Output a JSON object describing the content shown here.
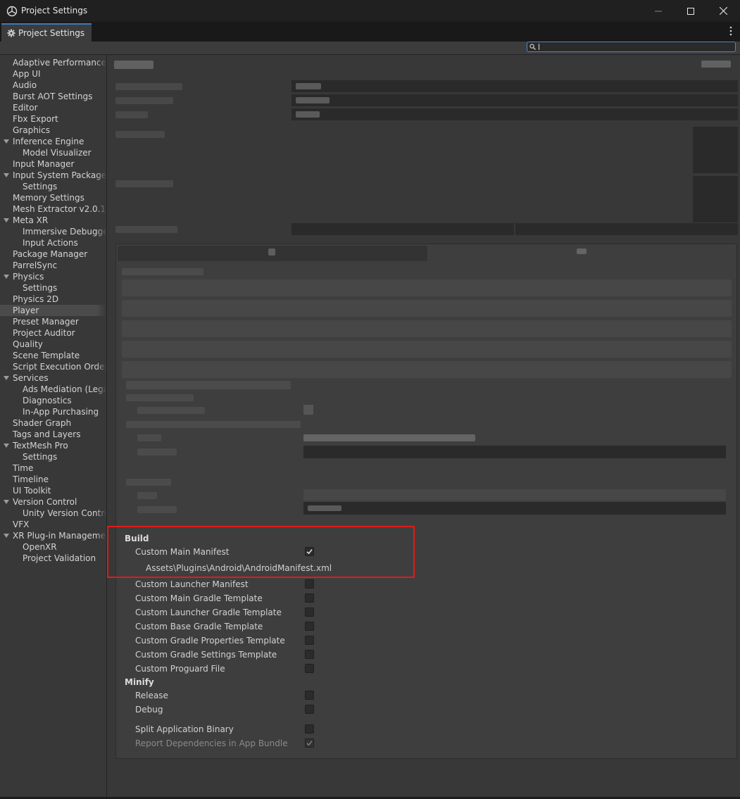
{
  "window": {
    "title": "Project Settings"
  },
  "tab": {
    "label": "Project Settings"
  },
  "search": {
    "value": "",
    "placeholder": ""
  },
  "sidebar": {
    "items": [
      {
        "label": "Adaptive Performance",
        "level": 0
      },
      {
        "label": "App UI",
        "level": 0
      },
      {
        "label": "Audio",
        "level": 0
      },
      {
        "label": "Burst AOT Settings",
        "level": 0
      },
      {
        "label": "Editor",
        "level": 0
      },
      {
        "label": "Fbx Export",
        "level": 0
      },
      {
        "label": "Graphics",
        "level": 0
      },
      {
        "label": "Inference Engine",
        "level": 0,
        "expanded": true
      },
      {
        "label": "Model Visualizer",
        "level": 1
      },
      {
        "label": "Input Manager",
        "level": 0
      },
      {
        "label": "Input System Package",
        "level": 0,
        "expanded": true
      },
      {
        "label": "Settings",
        "level": 1
      },
      {
        "label": "Memory Settings",
        "level": 0
      },
      {
        "label": "Mesh Extractor v2.0.1",
        "level": 0
      },
      {
        "label": "Meta XR",
        "level": 0,
        "expanded": true
      },
      {
        "label": "Immersive Debugger",
        "level": 1
      },
      {
        "label": "Input Actions",
        "level": 1
      },
      {
        "label": "Package Manager",
        "level": 0
      },
      {
        "label": "ParrelSync",
        "level": 0
      },
      {
        "label": "Physics",
        "level": 0,
        "expanded": true
      },
      {
        "label": "Settings",
        "level": 1
      },
      {
        "label": "Physics 2D",
        "level": 0
      },
      {
        "label": "Player",
        "level": 0,
        "selected": true
      },
      {
        "label": "Preset Manager",
        "level": 0
      },
      {
        "label": "Project Auditor",
        "level": 0
      },
      {
        "label": "Quality",
        "level": 0
      },
      {
        "label": "Scene Template",
        "level": 0
      },
      {
        "label": "Script Execution Order",
        "level": 0
      },
      {
        "label": "Services",
        "level": 0,
        "expanded": true
      },
      {
        "label": "Ads Mediation (Legacy)",
        "level": 1
      },
      {
        "label": "Diagnostics",
        "level": 1
      },
      {
        "label": "In-App Purchasing",
        "level": 1
      },
      {
        "label": "Shader Graph",
        "level": 0
      },
      {
        "label": "Tags and Layers",
        "level": 0
      },
      {
        "label": "TextMesh Pro",
        "level": 0,
        "expanded": true
      },
      {
        "label": "Settings",
        "level": 1
      },
      {
        "label": "Time",
        "level": 0
      },
      {
        "label": "Timeline",
        "level": 0
      },
      {
        "label": "UI Toolkit",
        "level": 0
      },
      {
        "label": "Version Control",
        "level": 0,
        "expanded": true
      },
      {
        "label": "Unity Version Control",
        "level": 1
      },
      {
        "label": "VFX",
        "level": 0
      },
      {
        "label": "XR Plug-in Management",
        "level": 0,
        "expanded": true
      },
      {
        "label": "OpenXR",
        "level": 1
      },
      {
        "label": "Project Validation",
        "level": 1
      }
    ]
  },
  "build": {
    "header": "Build",
    "custom_main_manifest": {
      "label": "Custom Main Manifest",
      "checked": true
    },
    "manifest_path": "Assets\\Plugins\\Android\\AndroidManifest.xml",
    "options": [
      {
        "label": "Custom Launcher Manifest",
        "checked": false
      },
      {
        "label": "Custom Main Gradle Template",
        "checked": false
      },
      {
        "label": "Custom Launcher Gradle Template",
        "checked": false
      },
      {
        "label": "Custom Base Gradle Template",
        "checked": false
      },
      {
        "label": "Custom Gradle Properties Template",
        "checked": false
      },
      {
        "label": "Custom Gradle Settings Template",
        "checked": false
      },
      {
        "label": "Custom Proguard File",
        "checked": false
      }
    ]
  },
  "minify": {
    "header": "Minify",
    "release": {
      "label": "Release",
      "checked": false
    },
    "debug": {
      "label": "Debug",
      "checked": false
    }
  },
  "split_binary": {
    "label": "Split Application Binary",
    "checked": false
  },
  "report_dependencies": {
    "label": "Report Dependencies in App Bundle",
    "checked": true,
    "disabled": true
  },
  "colors": {
    "highlight": "#e01b1b",
    "accent": "#4d88c8",
    "selected_row": "#4b4b4b"
  }
}
